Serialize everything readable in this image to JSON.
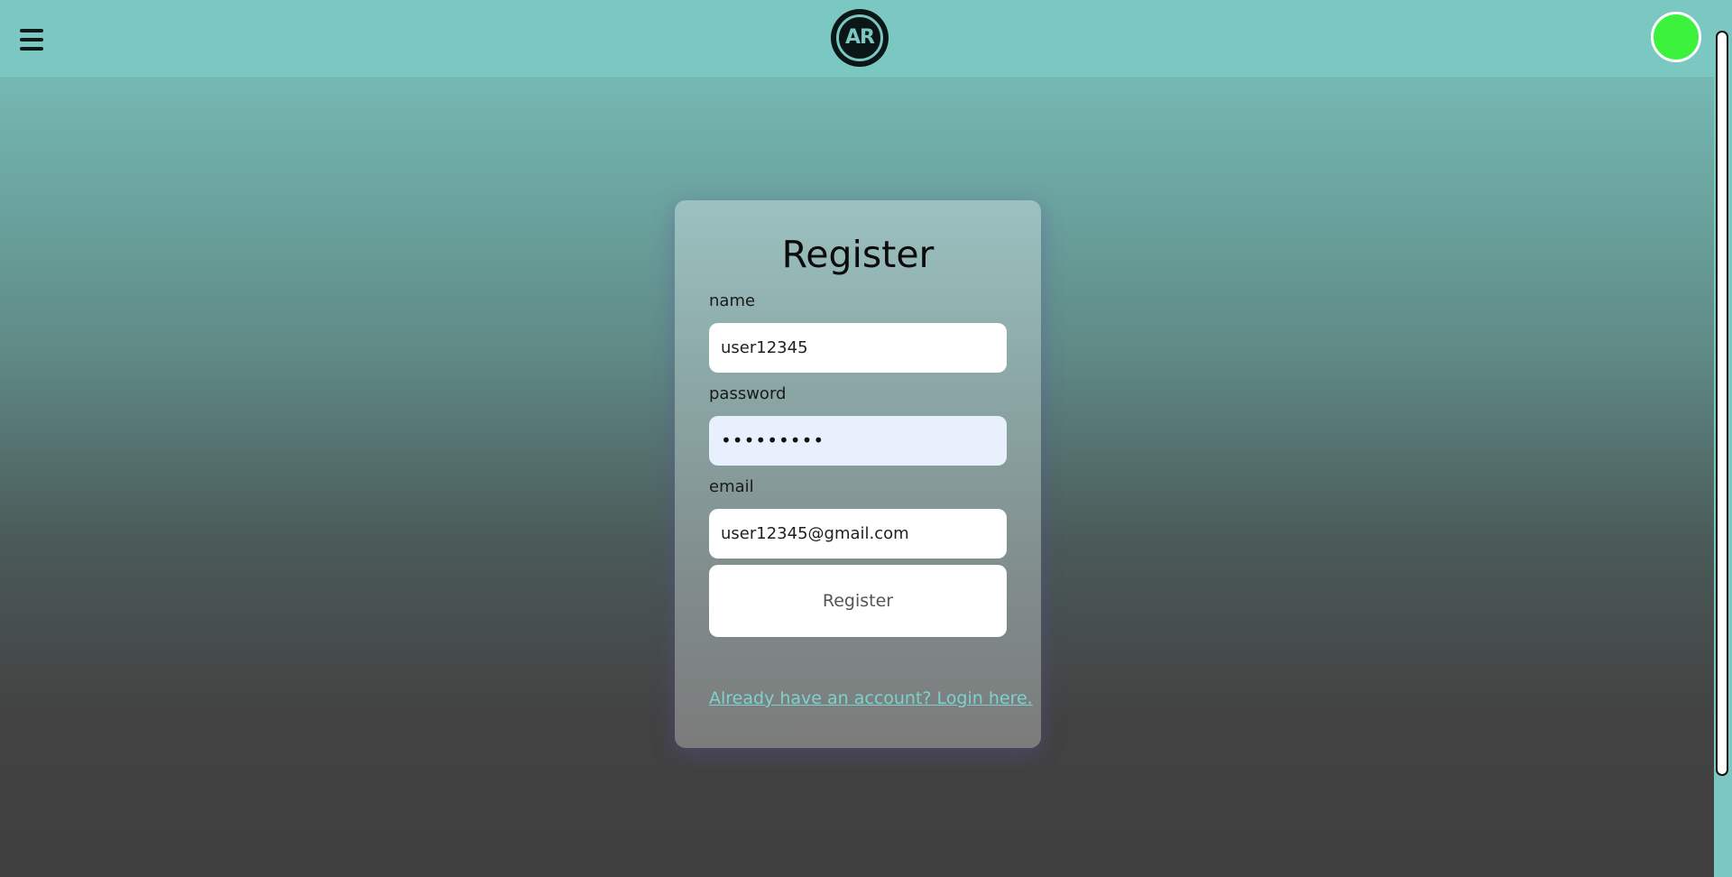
{
  "header": {
    "menu_icon": "hamburger-menu-icon",
    "logo_text": "AR",
    "status_indicator_color": "#3df23d",
    "accent_color": "#7bc7c2"
  },
  "form": {
    "title": "Register",
    "name_label": "name",
    "name_value": "user12345",
    "password_label": "password",
    "password_value": "•••••••••",
    "email_label": "email",
    "email_value": "user12345@gmail.com",
    "submit_label": "Register",
    "login_link": "Already have an account? Login here."
  }
}
